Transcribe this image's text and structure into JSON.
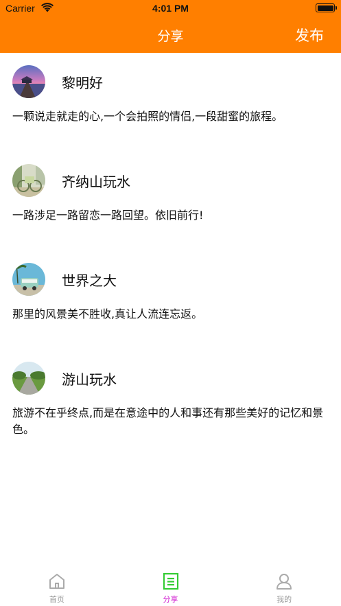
{
  "status_bar": {
    "carrier": "Carrier",
    "time": "4:01 PM"
  },
  "nav": {
    "title": "分享",
    "publish_label": "发布",
    "background_color": "#ff7f00"
  },
  "posts": [
    {
      "username": "黎明好",
      "text": "一颗说走就走的心,一个会拍照的情侣,一段甜蜜的旅程。",
      "avatar": "pier-sunset-avatar"
    },
    {
      "username": "齐纳山玩水",
      "text": "一路涉足一路留恋一路回望。依旧前行!",
      "avatar": "bicycle-avatar"
    },
    {
      "username": "世界之大",
      "text": "那里的风景美不胜收,真让人流连忘返。",
      "avatar": "van-palm-avatar"
    },
    {
      "username": "游山玩水",
      "text": "旅游不在乎终点,而是在意途中的人和事还有那些美好的记忆和景色。",
      "avatar": "country-road-avatar"
    }
  ],
  "tabbar": {
    "items": [
      {
        "label": "首页",
        "icon": "home-icon",
        "active": false
      },
      {
        "label": "分享",
        "icon": "share-doc-icon",
        "active": true
      },
      {
        "label": "我的",
        "icon": "person-icon",
        "active": false
      }
    ],
    "active_color": "#d020d0",
    "icon_active_color": "#33cc33",
    "inactive_color": "#999999"
  }
}
